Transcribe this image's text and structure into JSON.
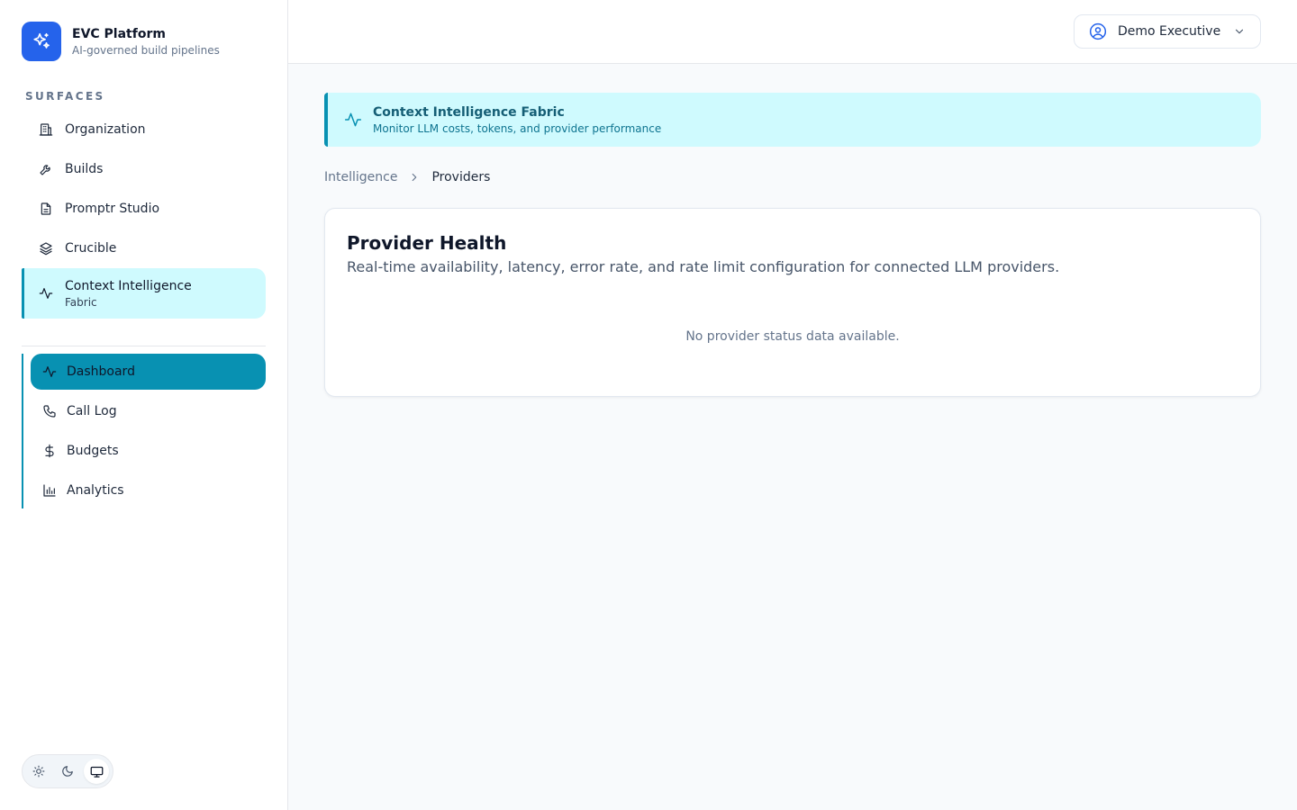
{
  "brand": {
    "title": "EVC Platform",
    "subtitle": "AI-governed build pipelines",
    "logo_icon": "sparkles-icon",
    "color": "#2563eb"
  },
  "sidebar": {
    "section_label": "SURFACES",
    "items": [
      {
        "label": "Organization",
        "icon": "building-icon"
      },
      {
        "label": "Builds",
        "icon": "wrench-icon"
      },
      {
        "label": "Promptr Studio",
        "icon": "document-icon"
      },
      {
        "label": "Crucible",
        "icon": "layers-icon"
      },
      {
        "label": "Context Intelligence",
        "sublabel": "Fabric",
        "icon": "activity-icon",
        "active": true
      }
    ],
    "subitems": [
      {
        "label": "Dashboard",
        "icon": "activity-icon",
        "active": true
      },
      {
        "label": "Call Log",
        "icon": "phone-icon"
      },
      {
        "label": "Budgets",
        "icon": "dollar-icon"
      },
      {
        "label": "Analytics",
        "icon": "bar-chart-icon"
      }
    ],
    "theme_options": [
      "sun-icon",
      "moon-icon",
      "monitor-icon"
    ],
    "theme_selected": "monitor-icon"
  },
  "topbar": {
    "user_name": "Demo Executive",
    "user_icon": "user-circle-icon"
  },
  "banner": {
    "title": "Context Intelligence Fabric",
    "subtitle": "Monitor LLM costs, tokens, and provider performance",
    "icon": "activity-icon",
    "accent": "#0891b2"
  },
  "breadcrumb": [
    "Intelligence",
    "Providers"
  ],
  "card": {
    "title": "Provider Health",
    "description": "Real-time availability, latency, error rate, and rate limit configuration for connected LLM providers.",
    "empty_state": "No provider status data available."
  }
}
